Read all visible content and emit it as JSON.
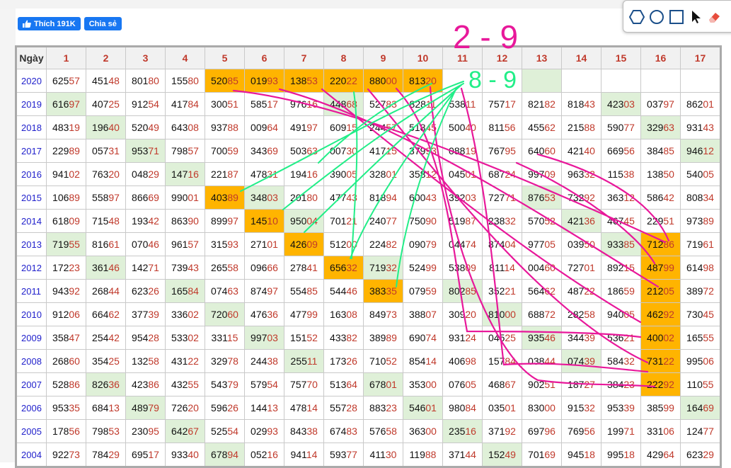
{
  "social": {
    "like_label": "Thích 191K",
    "share_label": "Chia sẻ"
  },
  "table": {
    "corner_label": "Ngày",
    "columns": [
      "1",
      "2",
      "3",
      "4",
      "5",
      "6",
      "7",
      "8",
      "9",
      "10",
      "11",
      "12",
      "13",
      "14",
      "15",
      "16",
      "17"
    ],
    "rows": [
      {
        "year": "2020",
        "cells": [
          "62557",
          "45148",
          "80180",
          "15580",
          "52085",
          "01993",
          "13853",
          "22022",
          "88000",
          "81320",
          "",
          "",
          "",
          "",
          "",
          "",
          ""
        ]
      },
      {
        "year": "2019",
        "cells": [
          "61697",
          "40725",
          "91254",
          "41784",
          "30051",
          "58517",
          "97616",
          "44868",
          "52783",
          "82811",
          "53811",
          "75717",
          "82182",
          "81843",
          "42303",
          "03797",
          "86201"
        ]
      },
      {
        "year": "2018",
        "cells": [
          "48319",
          "19640",
          "52049",
          "64308",
          "93788",
          "00964",
          "49197",
          "60915",
          "24457",
          "51845",
          "50040",
          "81156",
          "45562",
          "21588",
          "59077",
          "32963",
          "93143"
        ]
      },
      {
        "year": "2017",
        "cells": [
          "22989",
          "05731",
          "95371",
          "79857",
          "70059",
          "34369",
          "50363",
          "00730",
          "41715",
          "37993",
          "08819",
          "76795",
          "64060",
          "42140",
          "66956",
          "38485",
          "94612"
        ]
      },
      {
        "year": "2016",
        "cells": [
          "94102",
          "76320",
          "04829",
          "14716",
          "22187",
          "47831",
          "19416",
          "39005",
          "32801",
          "35812",
          "04501",
          "68724",
          "99709",
          "96332",
          "11538",
          "13850",
          "54005"
        ]
      },
      {
        "year": "2015",
        "cells": [
          "10689",
          "55897",
          "86669",
          "99001",
          "40389",
          "34803",
          "20180",
          "47743",
          "81894",
          "60043",
          "39203",
          "72771",
          "87653",
          "73292",
          "36312",
          "58642",
          "80834"
        ]
      },
      {
        "year": "2014",
        "cells": [
          "61809",
          "71548",
          "19342",
          "86390",
          "89997",
          "14510",
          "95004",
          "70121",
          "24077",
          "75090",
          "51987",
          "23832",
          "57052",
          "42136",
          "46745",
          "22951",
          "97389"
        ]
      },
      {
        "year": "2013",
        "cells": [
          "71955",
          "81661",
          "07046",
          "96157",
          "31593",
          "27101",
          "42609",
          "51200",
          "22482",
          "09079",
          "04474",
          "87404",
          "97705",
          "03950",
          "93385",
          "71286",
          "71961"
        ]
      },
      {
        "year": "2012",
        "cells": [
          "17223",
          "36146",
          "14271",
          "73943",
          "26558",
          "09666",
          "27841",
          "65632",
          "71932",
          "52499",
          "53809",
          "81114",
          "00460",
          "72701",
          "89215",
          "48799",
          "61498"
        ]
      },
      {
        "year": "2011",
        "cells": [
          "94392",
          "26844",
          "62326",
          "16584",
          "07463",
          "87497",
          "55485",
          "54446",
          "38335",
          "07959",
          "80285",
          "35221",
          "56462",
          "48722",
          "18659",
          "21205",
          "38972"
        ]
      },
      {
        "year": "2010",
        "cells": [
          "91206",
          "66462",
          "37739",
          "33602",
          "72060",
          "47636",
          "47799",
          "16308",
          "84973",
          "38807",
          "30920",
          "81000",
          "68872",
          "28258",
          "94005",
          "46292",
          "73045"
        ]
      },
      {
        "year": "2009",
        "cells": [
          "35847",
          "25442",
          "95428",
          "53302",
          "33115",
          "99703",
          "15152",
          "43382",
          "38989",
          "69074",
          "93124",
          "04525",
          "93546",
          "34439",
          "53621",
          "40002",
          "16555"
        ]
      },
      {
        "year": "2008",
        "cells": [
          "26860",
          "35425",
          "13258",
          "43122",
          "32978",
          "24438",
          "25511",
          "17326",
          "71052",
          "85414",
          "40698",
          "15784",
          "03844",
          "07439",
          "58432",
          "73122",
          "99506"
        ]
      },
      {
        "year": "2007",
        "cells": [
          "52886",
          "82636",
          "42386",
          "43255",
          "54379",
          "57954",
          "75770",
          "51364",
          "67801",
          "35300",
          "07605",
          "46867",
          "90251",
          "18727",
          "38423",
          "22292",
          "11055"
        ]
      },
      {
        "year": "2006",
        "cells": [
          "95335",
          "68413",
          "48979",
          "72620",
          "59626",
          "14413",
          "47814",
          "55728",
          "88323",
          "54601",
          "98084",
          "03501",
          "83000",
          "91532",
          "95339",
          "38599",
          "16469"
        ]
      },
      {
        "year": "2005",
        "cells": [
          "17856",
          "79853",
          "23095",
          "64267",
          "52554",
          "02993",
          "84338",
          "67483",
          "57658",
          "36300",
          "23516",
          "37192",
          "69796",
          "76956",
          "19971",
          "33106",
          "12477"
        ]
      },
      {
        "year": "2004",
        "cells": [
          "92273",
          "78429",
          "69517",
          "93340",
          "67894",
          "05216",
          "94114",
          "59377",
          "41130",
          "11988",
          "37144",
          "15249",
          "70169",
          "94518",
          "99518",
          "42964",
          "62329"
        ]
      }
    ]
  },
  "annotations": {
    "top_text": "2 - 9",
    "side_text": "8 - 9",
    "pink": "#e8189a",
    "green": "#22ee88"
  },
  "colors": {
    "orange": "#ffb400",
    "green_cell": "#dff0d8",
    "year_blue": "#2222cc",
    "accent_red": "#c0392b"
  },
  "toolbar": {
    "tools": [
      "hexagon-icon",
      "circle-icon",
      "square-icon",
      "cursor-icon",
      "eraser-icon"
    ]
  }
}
